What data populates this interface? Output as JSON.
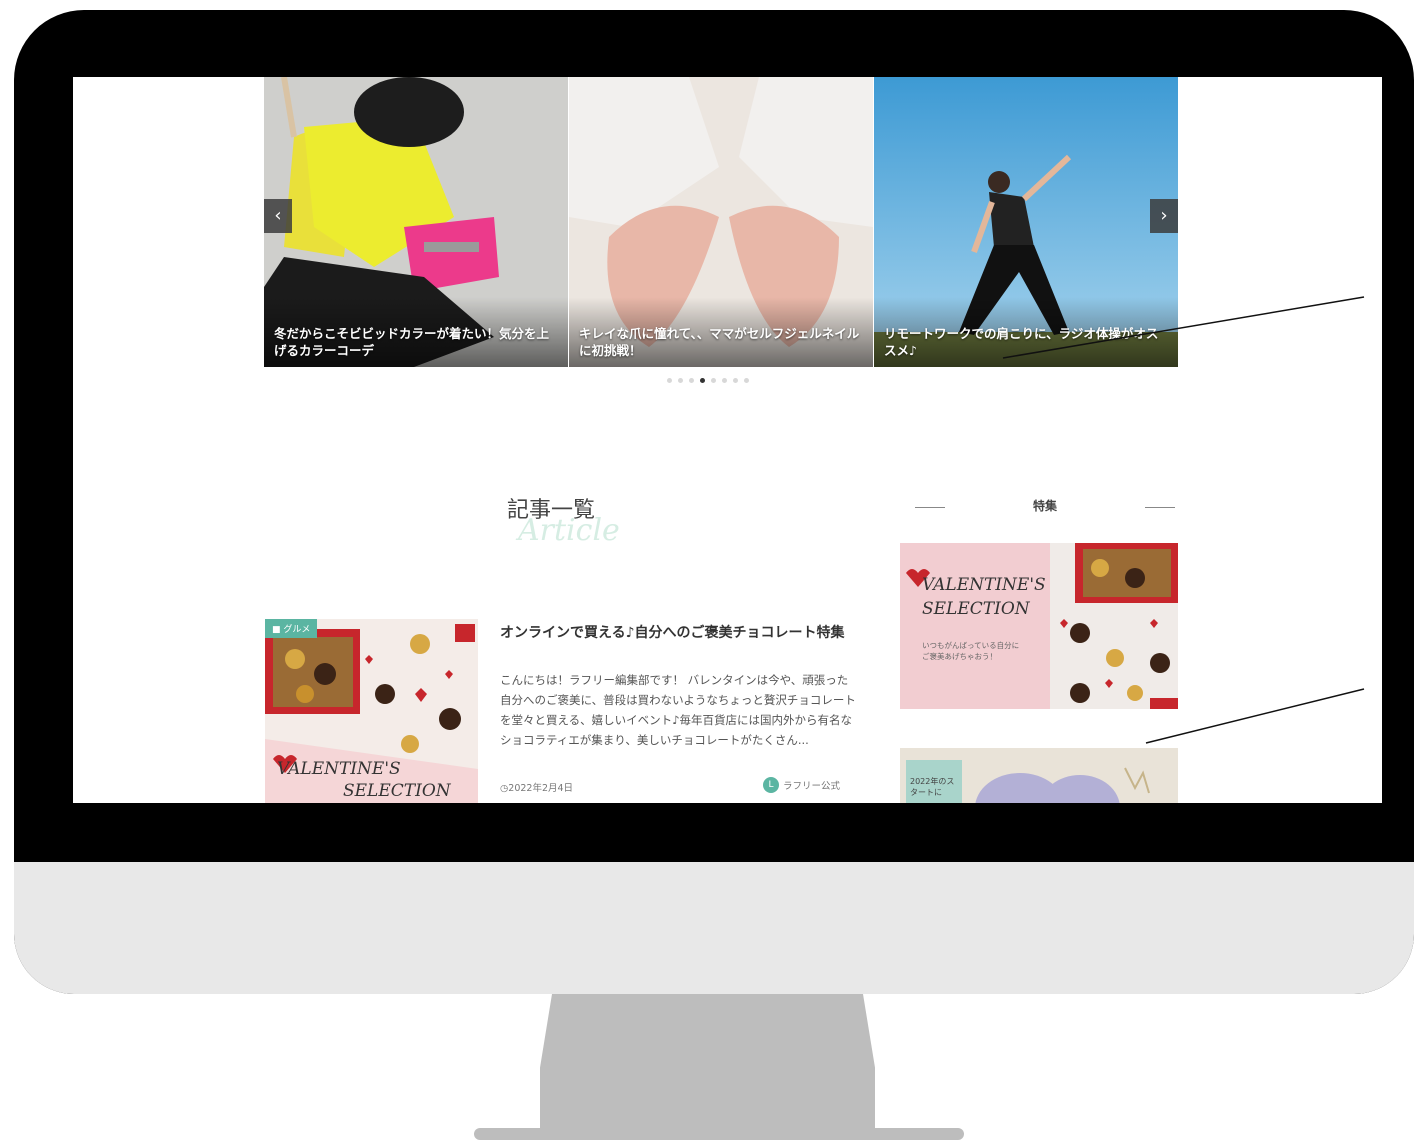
{
  "slider": {
    "prev_label": "‹",
    "next_label": "›",
    "slides": [
      {
        "caption": "冬だからこそビビッドカラーが着たい！気分を上げるカラーコーデ"
      },
      {
        "caption": "キレイな爪に憧れて、、ママがセルフジェルネイルに初挑戦！"
      },
      {
        "caption": "リモートワークでの肩こりに、ラジオ体操がオススメ♪"
      }
    ],
    "dot_count": 8,
    "active_dot": 4
  },
  "section": {
    "title": "記事一覧",
    "subtitle": "Article"
  },
  "article": {
    "category": "グルメ",
    "title": "オンラインで買える♪自分へのご褒美チョコレート特集",
    "excerpt": "こんにちは！ラフリー編集部です！ バレンタインは今や、頑張った自分へのご褒美に、普段は買わないようなちょっと贅沢チョコレートを堂々と買える、嬉しいイベント♪毎年百貨店には国内外から有名なショコラティエが集まり、美しいチョコレートがたくさん...",
    "date": "2022年2月4日",
    "author": "ラフリー公式",
    "thumb_text_1": "VALENTINE'S",
    "thumb_text_2": "SELECTION"
  },
  "sidebar": {
    "title": "特集",
    "banner": {
      "line1": "VALENTINE'S",
      "line2": "SELECTION",
      "tagline1": "いつもがんばっている自分に",
      "tagline2": "ご褒美あげちゃおう！"
    },
    "banner2_text": "2022年のスタートに"
  },
  "colors": {
    "accent": "#5bb5a2",
    "bezel": "#000000",
    "chin": "#e8e8e8",
    "stand": "#bdbdbd"
  }
}
